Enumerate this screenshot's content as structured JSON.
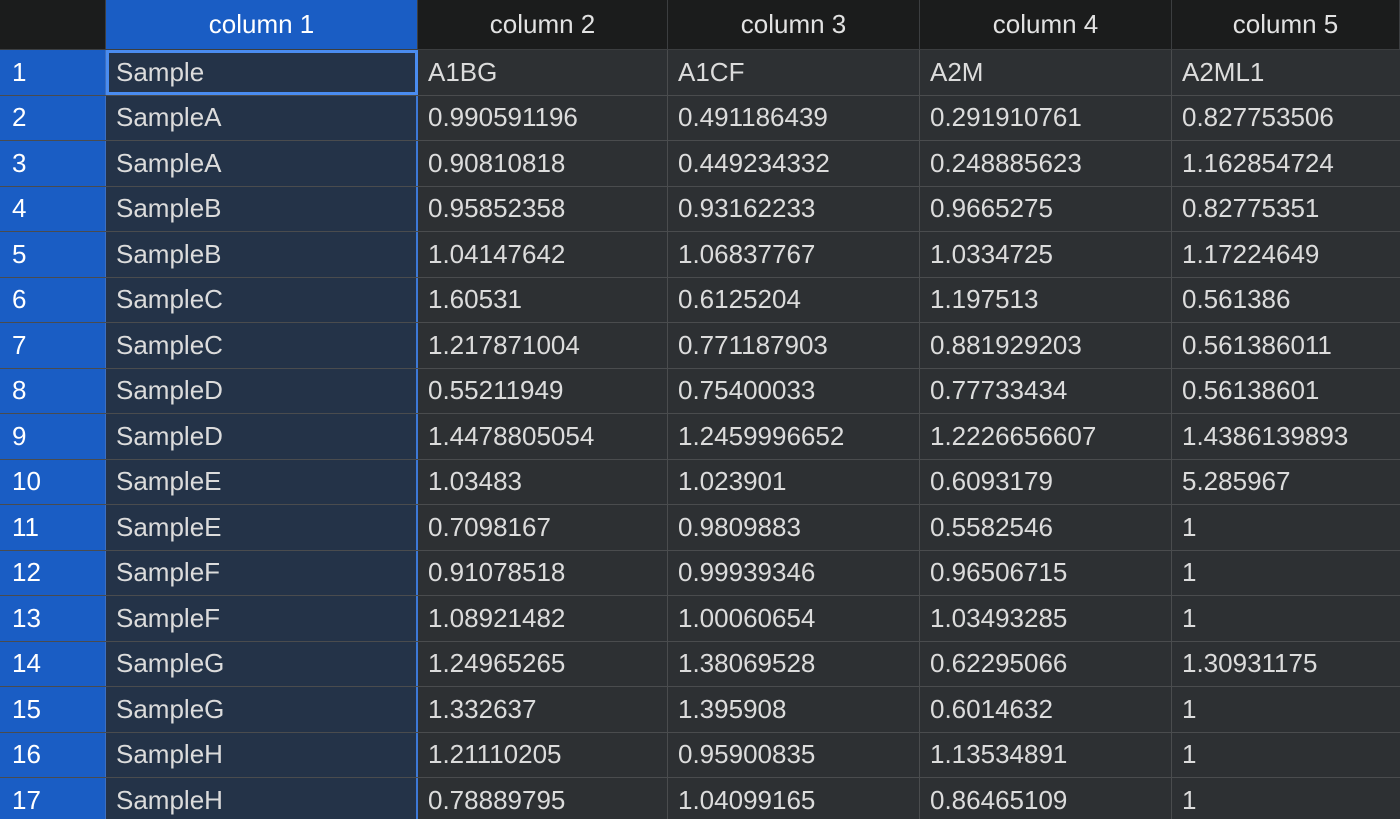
{
  "colors": {
    "selected_header": "#1a5dc4",
    "selected_column": "#243348",
    "cell_background": "#2d3033",
    "header_background": "#1b1c1c",
    "active_cell_border": "#4a8cf0"
  },
  "headers": [
    "column 1",
    "column 2",
    "column 3",
    "column 4",
    "column 5"
  ],
  "rows": [
    {
      "num": "1",
      "cells": [
        "Sample",
        "A1BG",
        "A1CF",
        "A2M",
        "A2ML1"
      ]
    },
    {
      "num": "2",
      "cells": [
        "SampleA",
        "0.990591196",
        "0.491186439",
        "0.291910761",
        "0.827753506"
      ]
    },
    {
      "num": "3",
      "cells": [
        "SampleA",
        "0.90810818",
        "0.449234332",
        "0.248885623",
        "1.162854724"
      ]
    },
    {
      "num": "4",
      "cells": [
        "SampleB",
        "0.95852358",
        "0.93162233",
        "0.9665275",
        "0.82775351"
      ]
    },
    {
      "num": "5",
      "cells": [
        "SampleB",
        "1.04147642",
        "1.06837767",
        "1.0334725",
        "1.17224649"
      ]
    },
    {
      "num": "6",
      "cells": [
        "SampleC",
        "1.60531",
        "0.6125204",
        "1.197513",
        "0.561386"
      ]
    },
    {
      "num": "7",
      "cells": [
        "SampleC",
        "1.217871004",
        "0.771187903",
        "0.881929203",
        "0.561386011"
      ]
    },
    {
      "num": "8",
      "cells": [
        "SampleD",
        "0.55211949",
        "0.75400033",
        "0.77733434",
        "0.56138601"
      ]
    },
    {
      "num": "9",
      "cells": [
        "SampleD",
        "1.4478805054",
        "1.2459996652",
        "1.2226656607",
        "1.4386139893"
      ]
    },
    {
      "num": "10",
      "cells": [
        "SampleE",
        "1.03483",
        "1.023901",
        "0.6093179",
        "5.285967"
      ]
    },
    {
      "num": "11",
      "cells": [
        "SampleE",
        "0.7098167",
        "0.9809883",
        "0.5582546",
        "1"
      ]
    },
    {
      "num": "12",
      "cells": [
        "SampleF",
        "0.91078518",
        "0.99939346",
        "0.96506715",
        "1"
      ]
    },
    {
      "num": "13",
      "cells": [
        "SampleF",
        "1.08921482",
        "1.00060654",
        "1.03493285",
        "1"
      ]
    },
    {
      "num": "14",
      "cells": [
        "SampleG",
        "1.24965265",
        "1.38069528",
        "0.62295066",
        "1.30931175"
      ]
    },
    {
      "num": "15",
      "cells": [
        "SampleG",
        "1.332637",
        "1.395908",
        "0.6014632",
        "1"
      ]
    },
    {
      "num": "16",
      "cells": [
        "SampleH",
        "1.21110205",
        "0.95900835",
        "1.13534891",
        "1"
      ]
    },
    {
      "num": "17",
      "cells": [
        "SampleH",
        "0.78889795",
        "1.04099165",
        "0.86465109",
        "1"
      ]
    }
  ]
}
